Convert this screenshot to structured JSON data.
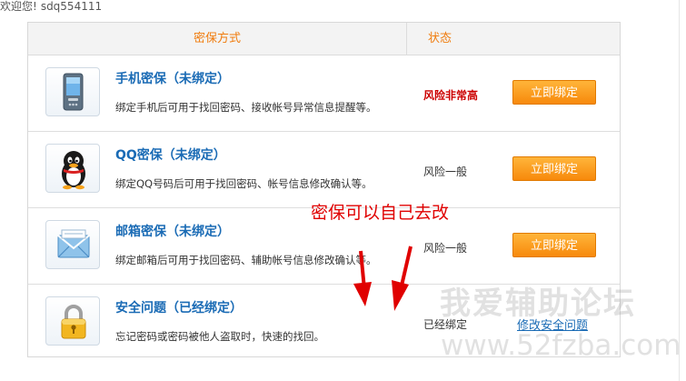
{
  "welcome": {
    "prefix": "欢迎您!",
    "username": "sdq554111"
  },
  "table": {
    "header_method": "密保方式",
    "header_status": "状态"
  },
  "rows": [
    {
      "title": "手机密保（未绑定）",
      "desc": "绑定手机后可用于找回密码、接收帐号异常信息提醒等。",
      "status": "风险非常高",
      "action": "立即绑定",
      "icon": "mobile-phone-icon"
    },
    {
      "title": "QQ密保（未绑定）",
      "desc": "绑定QQ号码后可用于找回密码、帐号信息修改确认等。",
      "status": "风险一般",
      "action": "立即绑定",
      "icon": "qq-penguin-icon"
    },
    {
      "title": "邮箱密保（未绑定）",
      "desc": "绑定邮箱后可用于找回密码、辅助帐号信息修改确认等。",
      "status": "风险一般",
      "action": "立即绑定",
      "icon": "envelope-icon"
    },
    {
      "title": "安全问题（已经绑定）",
      "desc": "忘记密码或密码被他人盗取时，快速的找回。",
      "status": "已经绑定",
      "action": "修改安全问题",
      "icon": "padlock-icon"
    }
  ],
  "annotation": "密保可以自己去改",
  "watermark": {
    "line1": "我爱辅助论坛",
    "line2": "www.52fzba.com"
  },
  "colors": {
    "accent_orange": "#f07c0e",
    "button_orange": "#f7890b",
    "title_blue": "#1a6bb5",
    "risk_red": "#cc0000",
    "annotation_red": "#e00000"
  }
}
